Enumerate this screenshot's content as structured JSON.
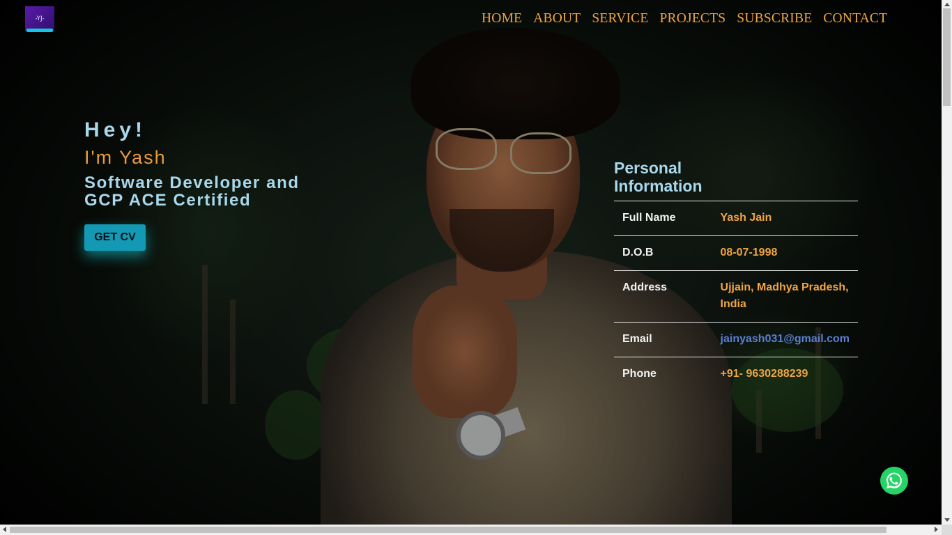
{
  "header": {
    "logo_text": "-YJ-",
    "nav": [
      "HOME",
      "ABOUT",
      "SERVICE",
      "PROJECTS",
      "SUBSCRIBE",
      "CONTACT"
    ]
  },
  "hero": {
    "greeting": "Hey!",
    "name_line": "I'm Yash",
    "role": "Software Developer and GCP ACE Certified",
    "cv_button": "GET CV"
  },
  "personal_info": {
    "title": "Personal Information",
    "rows": [
      {
        "label": "Full Name",
        "value": "Yash Jain"
      },
      {
        "label": "D.O.B",
        "value": "08-07-1998"
      },
      {
        "label": "Address",
        "value": "Ujjain, Madhya Pradesh, India"
      },
      {
        "label": "Email",
        "value": "jainyash031@gmail.com"
      },
      {
        "label": "Phone",
        "value": "+91- 9630288239"
      }
    ]
  },
  "colors": {
    "accent_orange": "#f0a545",
    "light_blue": "#a9d8ec",
    "button_teal": "#1399b3",
    "whatsapp_green": "#25d366",
    "email_blue": "#5a7ed3"
  },
  "icons": {
    "whatsapp": "whatsapp-icon"
  }
}
